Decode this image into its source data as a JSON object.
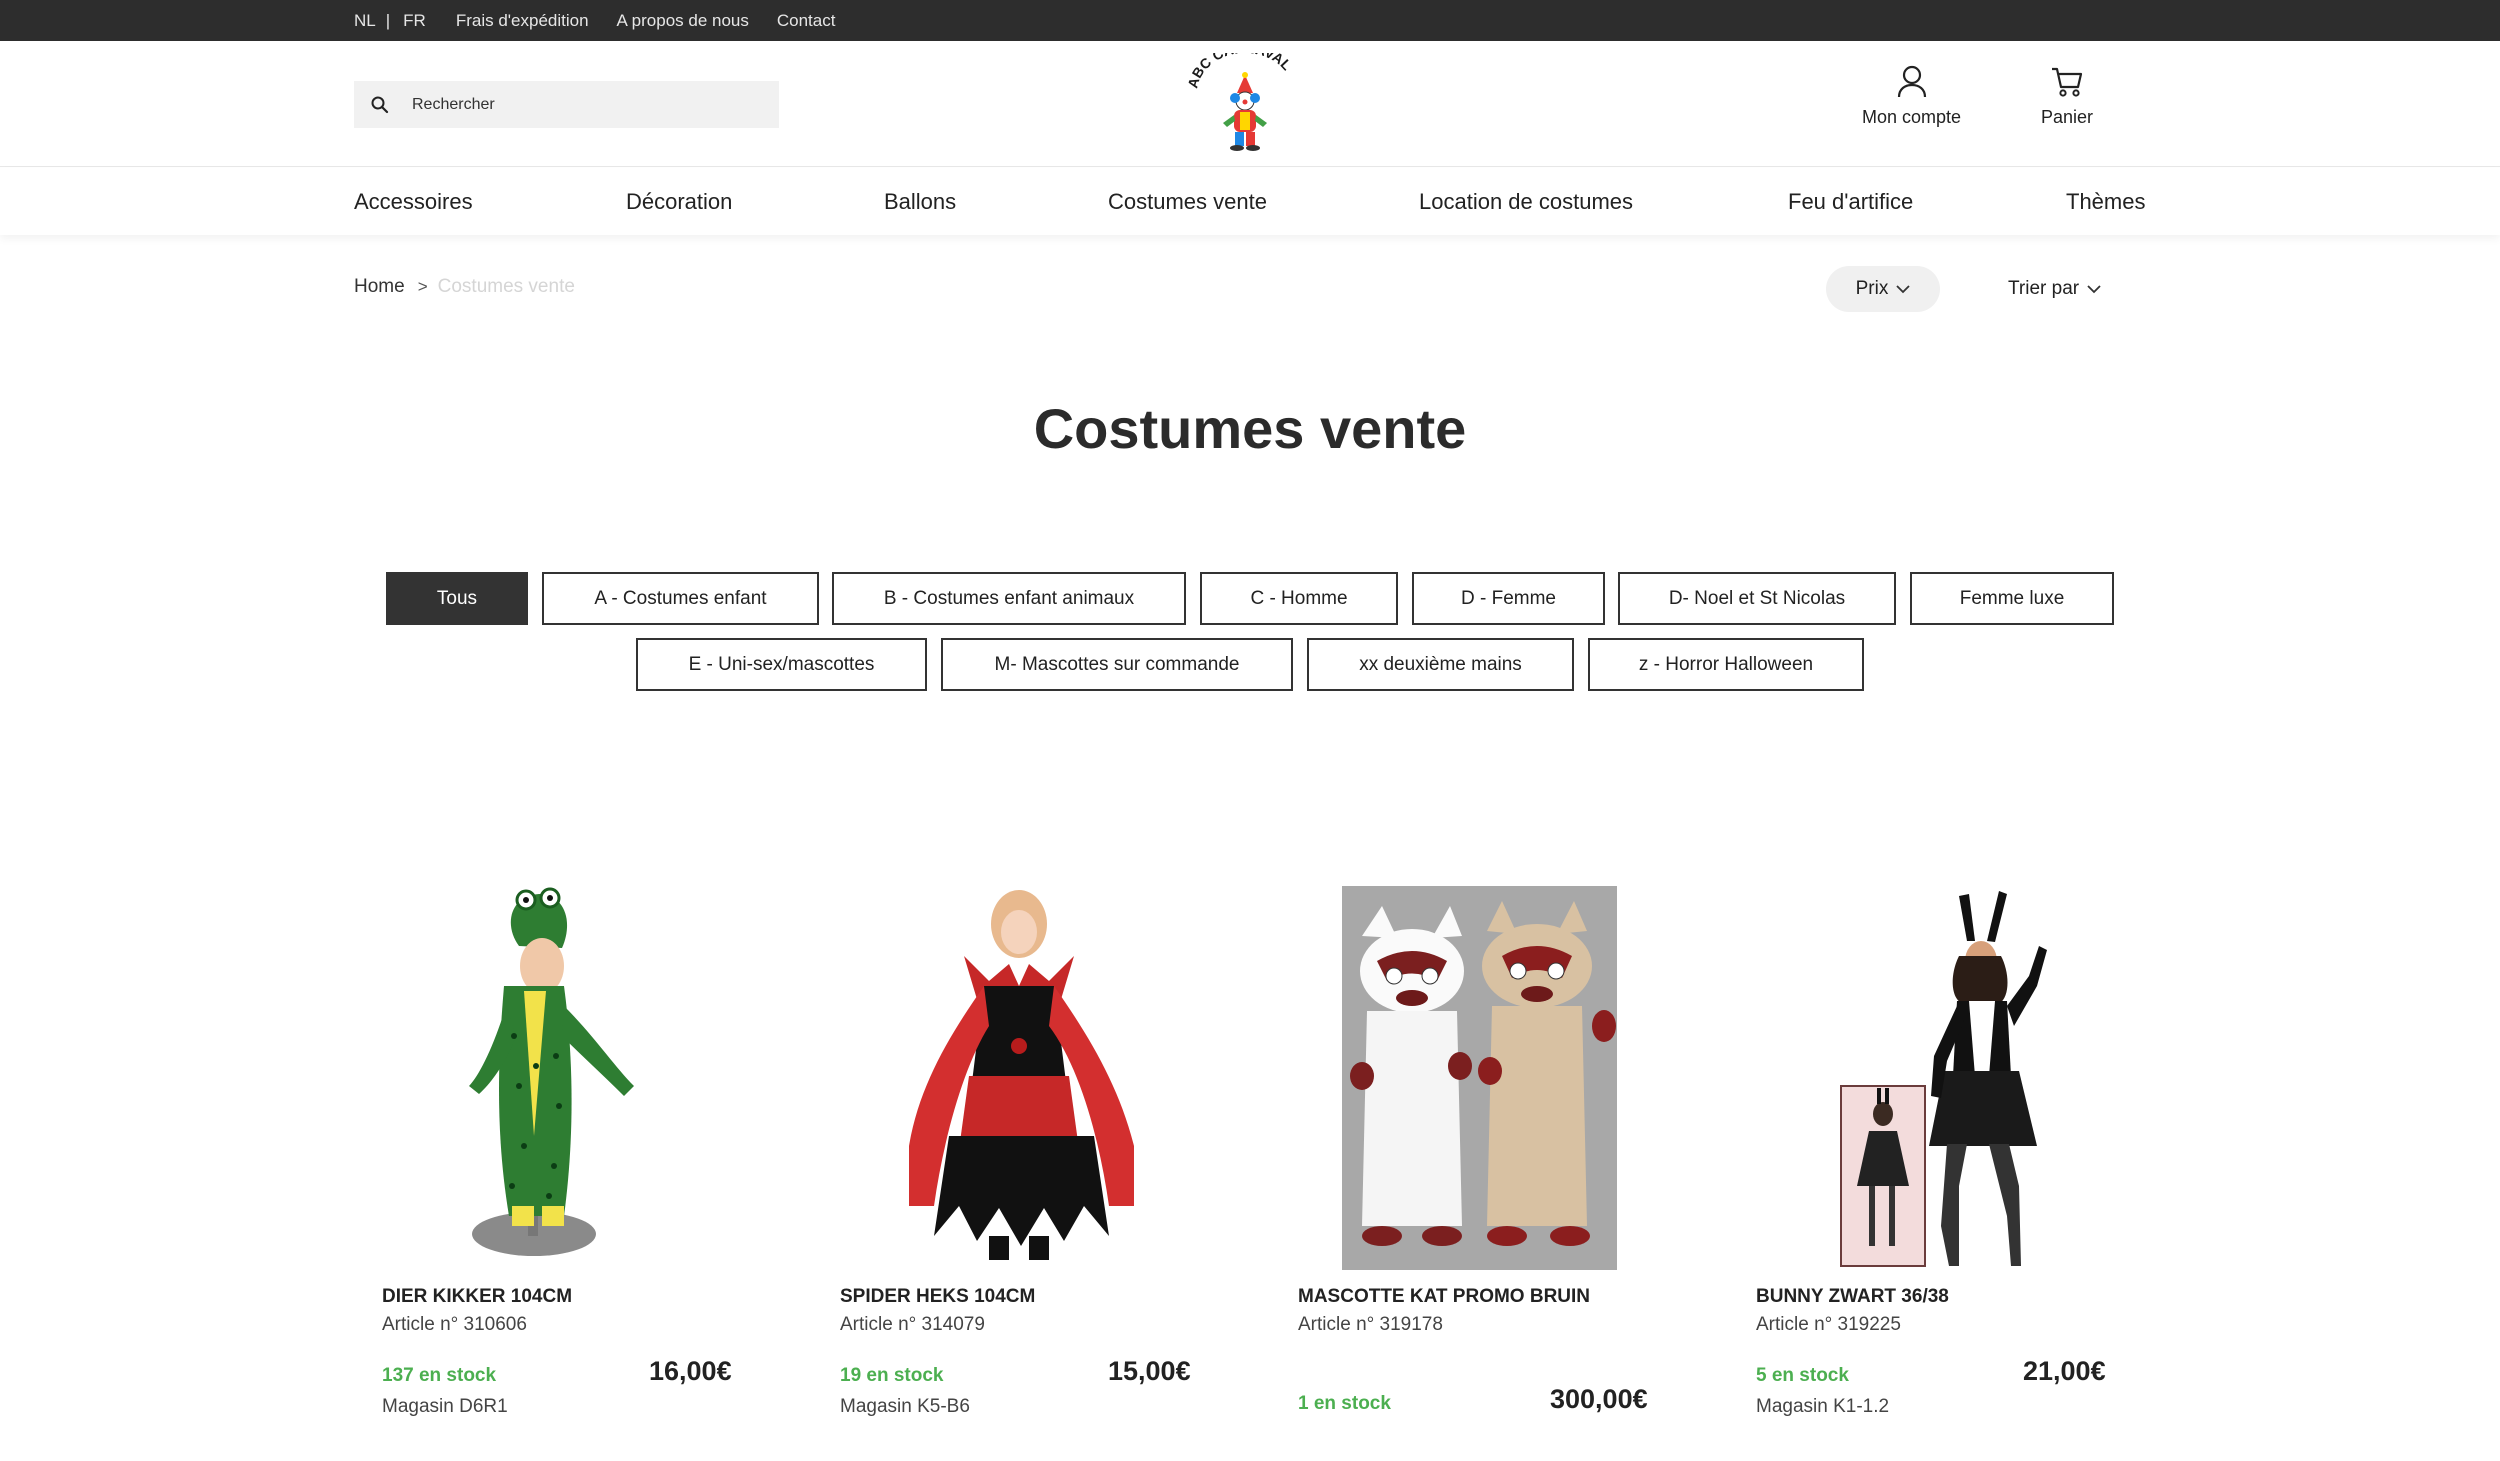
{
  "topbar": {
    "lang_nl": "NL",
    "separator": "|",
    "lang_fr": "FR",
    "links": [
      "Frais d'expédition",
      "A propos de nous",
      "Contact"
    ]
  },
  "header": {
    "search_placeholder": "Rechercher",
    "logo_text": "ABC CARNAVAL",
    "account_label": "Mon compte",
    "cart_label": "Panier"
  },
  "nav": {
    "items": [
      "Accessoires",
      "Décoration",
      "Ballons",
      "Costumes vente",
      "Location de costumes",
      "Feu d'artifice",
      "Thèmes"
    ]
  },
  "breadcrumb": {
    "home": "Home",
    "separator": ">",
    "current": "Costumes vente"
  },
  "filters": {
    "price_label": "Prix",
    "sort_label": "Trier par"
  },
  "page_title": "Costumes vente",
  "categories": [
    "Tous",
    "A - Costumes enfant",
    "B - Costumes enfant animaux",
    "C - Homme",
    "D - Femme",
    "D- Noel et St Nicolas",
    "Femme luxe",
    "E - Uni-sex/mascottes",
    "M- Mascottes sur commande",
    "xx deuxième mains",
    "z - Horror Halloween"
  ],
  "active_category": "Tous",
  "products": [
    {
      "name": "DIER KIKKER 104CM",
      "article": "Article n° 310606",
      "stock": "137 en stock",
      "store": "Magasin D6R1",
      "price": "16,00€"
    },
    {
      "name": "SPIDER HEKS 104CM",
      "article": "Article n° 314079",
      "stock": "19 en stock",
      "store": "Magasin K5-B6",
      "price": "15,00€"
    },
    {
      "name": "MASCOTTE KAT PROMO BRUIN",
      "article": "Article n° 319178",
      "stock": "1 en stock",
      "store": "",
      "price": "300,00€"
    },
    {
      "name": "BUNNY ZWART 36/38",
      "article": "Article n° 319225",
      "stock": "5 en stock",
      "store": "Magasin K1-1.2",
      "price": "21,00€"
    }
  ],
  "colors": {
    "topbar_bg": "#2d2d2d",
    "stock_green": "#4caf50",
    "chip_active_bg": "#333333"
  },
  "icons": {
    "search": "search-icon",
    "account": "user-icon",
    "cart": "cart-icon",
    "chevron": "chevron-down-icon"
  }
}
